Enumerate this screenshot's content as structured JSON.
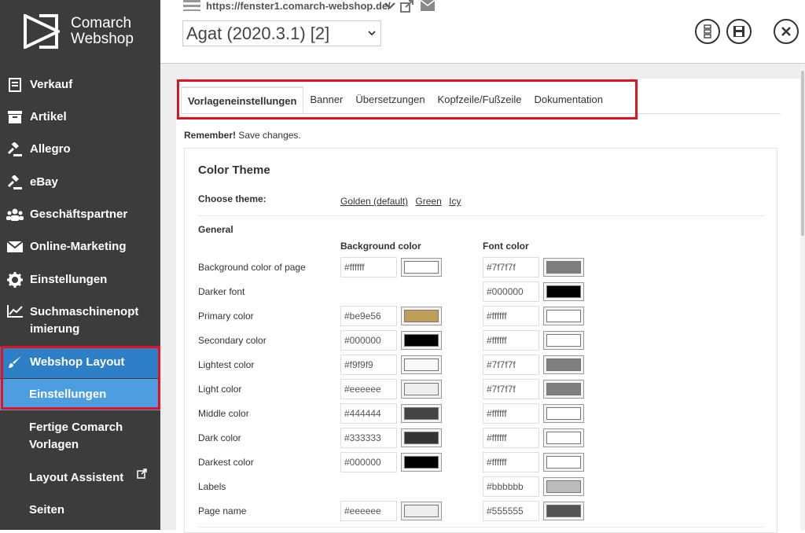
{
  "app": {
    "logo_line1": "Comarch",
    "logo_line2": "Webshop"
  },
  "sidebar": {
    "items": [
      {
        "label": "Verkauf",
        "icon": "receipt-icon"
      },
      {
        "label": "Artikel",
        "icon": "box-icon"
      },
      {
        "label": "Allegro",
        "icon": "gavel-icon"
      },
      {
        "label": "eBay",
        "icon": "gavel-icon"
      },
      {
        "label": "Geschäftspartner",
        "icon": "users-icon"
      },
      {
        "label": "Online-Marketing",
        "icon": "envelope-icon"
      },
      {
        "label": "Einstellungen",
        "icon": "gear-icon"
      },
      {
        "label_line1": "Suchmaschinenopt",
        "label_line2": "imierung",
        "icon": "chart-line-icon"
      },
      {
        "label": "Webshop Layout",
        "icon": "brush-icon"
      }
    ],
    "sub_items": [
      {
        "label": "Einstellungen"
      },
      {
        "label_line1": "Fertige Comarch",
        "label_line2": "Vorlagen"
      },
      {
        "label": "Layout Assistent"
      },
      {
        "label": "Seiten"
      }
    ]
  },
  "topbar": {
    "url": "https://fenster1.comarch-webshop.de/",
    "version": "Agat (2020.3.1) [2]"
  },
  "tabs": [
    {
      "label": "Vorlageneinstellungen",
      "active": true
    },
    {
      "label": "Banner"
    },
    {
      "label": "Übersetzungen"
    },
    {
      "label": "Kopfzeile/Fußzeile"
    },
    {
      "label": "Dokumentation"
    }
  ],
  "remember": {
    "bold": "Remember!",
    "text": " Save changes."
  },
  "color_theme": {
    "title": "Color Theme",
    "choose_label": "Choose theme:",
    "themes": [
      "Golden (default)",
      "Green",
      "Icy"
    ],
    "section": "General",
    "bg_header": "Background color",
    "font_header": "Font color",
    "rows": [
      {
        "label": "Background color of page",
        "bg": "#ffffff",
        "font": "#7f7f7f"
      },
      {
        "label": "Darker font",
        "bg": null,
        "font": "#000000"
      },
      {
        "label": "Primary color",
        "bg": "#be9e56",
        "font": "#ffffff"
      },
      {
        "label": "Secondary color",
        "bg": "#000000",
        "font": "#ffffff"
      },
      {
        "label": "Lightest color",
        "bg": "#f9f9f9",
        "font": "#7f7f7f"
      },
      {
        "label": "Light color",
        "bg": "#eeeeee",
        "font": "#7f7f7f"
      },
      {
        "label": "Middle color",
        "bg": "#444444",
        "font": "#ffffff"
      },
      {
        "label": "Dark color",
        "bg": "#333333",
        "font": "#ffffff"
      },
      {
        "label": "Darkest color",
        "bg": "#000000",
        "font": "#ffffff"
      },
      {
        "label": "Labels",
        "bg": null,
        "font": "#bbbbbb"
      },
      {
        "label": "Page name",
        "bg": "#eeeeee",
        "font": "#555555"
      }
    ]
  },
  "colors": {
    "sidebar_bg": "#3c3c3c",
    "active_nav": "#2d7fc7",
    "active_sub": "#4d9de0",
    "highlight_border": "#e0131f"
  }
}
